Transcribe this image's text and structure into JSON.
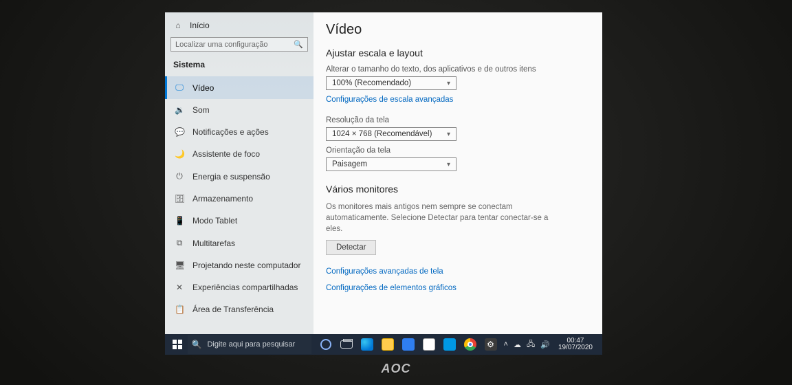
{
  "sidebar": {
    "home_label": "Início",
    "search_placeholder": "Localizar uma configuração",
    "section_label": "Sistema",
    "items": [
      {
        "icon": "🖵",
        "label": "Vídeo",
        "selected": true
      },
      {
        "icon": "🔉",
        "label": "Som"
      },
      {
        "icon": "💬",
        "label": "Notificações e ações"
      },
      {
        "icon": "🌙",
        "label": "Assistente de foco"
      },
      {
        "icon": "⏻",
        "label": "Energia e suspensão"
      },
      {
        "icon": "🗄",
        "label": "Armazenamento"
      },
      {
        "icon": "📱",
        "label": "Modo Tablet"
      },
      {
        "icon": "⧉",
        "label": "Multitarefas"
      },
      {
        "icon": "🖥",
        "label": "Projetando neste computador"
      },
      {
        "icon": "✕",
        "label": "Experiências compartilhadas"
      },
      {
        "icon": "📋",
        "label": "Área de Transferência"
      }
    ]
  },
  "content": {
    "page_title": "Vídeo",
    "scale_section": "Ajustar escala e layout",
    "scale_label": "Alterar o tamanho do texto, dos aplicativos e de outros itens",
    "scale_value": "100% (Recomendado)",
    "scale_advanced_link": "Configurações de escala avançadas",
    "resolution_label": "Resolução da tela",
    "resolution_value": "1024 × 768 (Recomendável)",
    "orientation_label": "Orientação da tela",
    "orientation_value": "Paisagem",
    "multi_section": "Vários monitores",
    "multi_help": "Os monitores mais antigos nem sempre se conectam automaticamente. Selecione Detectar para tentar conectar-se a eles.",
    "detect_button": "Detectar",
    "adv_display_link": "Configurações avançadas de tela",
    "graphics_link": "Configurações de elementos gráficos"
  },
  "taskbar": {
    "search_placeholder": "Digite aqui para pesquisar",
    "time": "00:47",
    "date": "19/07/2020"
  },
  "monitor_brand": "AOC"
}
